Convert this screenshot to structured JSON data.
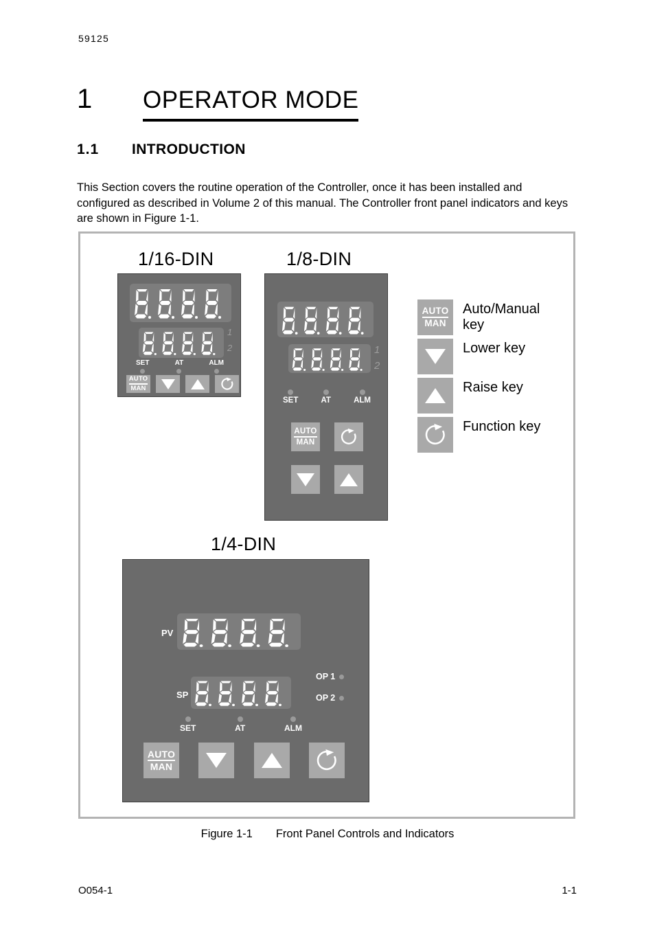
{
  "page": {
    "doc_number": "59125",
    "footer_left": "O054-1",
    "footer_right": "1-1"
  },
  "chapter": {
    "number": "1",
    "title": "OPERATOR MODE"
  },
  "section": {
    "number": "1.1",
    "title": "INTRODUCTION",
    "body": "This Section covers the routine operation of the Controller, once it has been installed and configured as described in Volume 2 of this manual. The Controller front panel indicators and keys are shown in Figure 1-1."
  },
  "figure": {
    "caption_label": "Figure 1-1",
    "caption_text": "Front Panel Controls and Indicators"
  },
  "panels": {
    "din16": {
      "title": "1/16-DIN",
      "upper_display": "8.8.8.8.",
      "lower_display": "8.8.8.8.",
      "side_digits": [
        "1",
        "2"
      ],
      "indicators": [
        "SET",
        "AT",
        "ALM"
      ],
      "keys": [
        "AUTO/MAN",
        "Lower",
        "Raise",
        "Function"
      ]
    },
    "din8": {
      "title": "1/8-DIN",
      "upper_display": "8.8.8.8.",
      "lower_display": "8.8.8.8.",
      "side_digits": [
        "1",
        "2"
      ],
      "indicators": [
        "SET",
        "AT",
        "ALM"
      ],
      "keys": [
        "AUTO/MAN",
        "Function",
        "Lower",
        "Raise"
      ]
    },
    "din4": {
      "title": "1/4-DIN",
      "pv_label": "PV",
      "sp_label": "SP",
      "pv_display": "8.8.8.8.",
      "sp_display": "8.8.8.8.",
      "outputs": [
        "OP 1",
        "OP 2"
      ],
      "indicators": [
        "SET",
        "AT",
        "ALM"
      ],
      "keys": [
        "AUTO/MAN",
        "Lower",
        "Raise",
        "Function"
      ]
    }
  },
  "key_labels": {
    "auto_top": "AUTO",
    "auto_bottom": "MAN"
  },
  "legend": [
    {
      "icon": "auto-manual-key-icon",
      "text": "Auto/Manual\nkey"
    },
    {
      "icon": "down-arrow-key-icon",
      "text": "Lower key"
    },
    {
      "icon": "up-arrow-key-icon",
      "text": "Raise key"
    },
    {
      "icon": "function-key-icon",
      "text": "Function key"
    }
  ],
  "colors": {
    "panel_body": "#6b6b6b",
    "display_bg": "#7d7d7d",
    "key_face": "#a9a9a9",
    "segment": "#ffffff",
    "lamp": "#9a9a9a",
    "frame_border": "#b3b3b3"
  }
}
